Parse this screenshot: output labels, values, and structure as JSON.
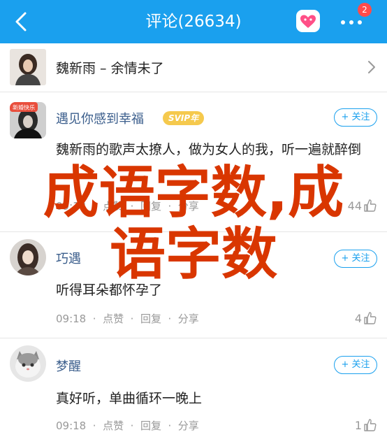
{
  "header": {
    "title": "评论(26634)",
    "notification_count": "2"
  },
  "song": {
    "title": "魏新雨 – 余情未了"
  },
  "comments": [
    {
      "username": "遇见你感到幸福",
      "vip_label": "SVIP年",
      "follow_label": "+ 关注",
      "content": "魏新雨的歌声太撩人，做为女人的我，听一遍就醉倒",
      "time": "09:13",
      "like_label": "点赞",
      "reply_label": "回复",
      "share_label": "分享",
      "likes": "44",
      "avatar_caption": "新婚快乐"
    },
    {
      "username": "巧遇",
      "follow_label": "+ 关注",
      "content": "听得耳朵都怀孕了",
      "time": "09:18",
      "like_label": "点赞",
      "reply_label": "回复",
      "share_label": "分享",
      "likes": "4"
    },
    {
      "username": "梦醒",
      "follow_label": "+ 关注",
      "content": "真好听，单曲循环一晚上",
      "time": "09:18",
      "like_label": "点赞",
      "reply_label": "回复",
      "share_label": "分享",
      "likes": "1"
    }
  ],
  "separator": "  ·  ",
  "watermark": {
    "line1": "成语字数,成",
    "line2": "语字数"
  },
  "colors": {
    "header_blue": "#1aa0ee",
    "username_blue": "#3b5e8c",
    "watermark_red": "#d93600",
    "vip_gold": "#f5c94d"
  }
}
